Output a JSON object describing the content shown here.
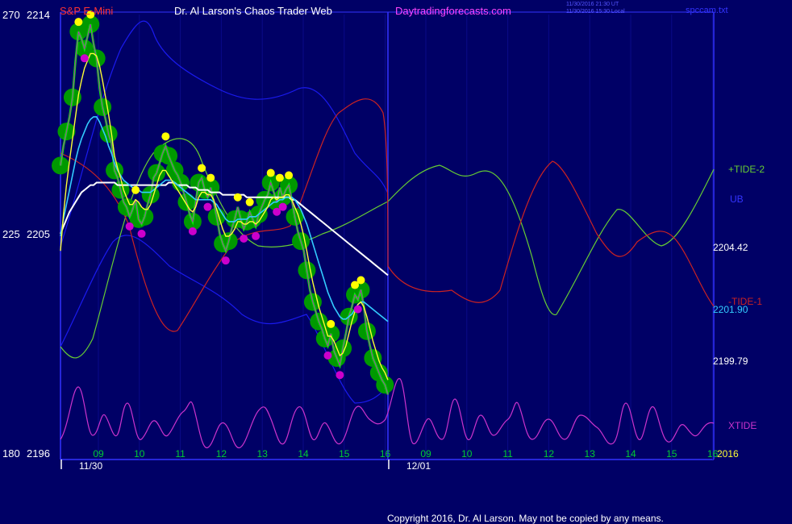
{
  "header": {
    "symbol": "S&P E-Mini",
    "title": "Dr. Al Larson's Chaos Trader Web",
    "site": "Daytradingforecasts.com",
    "stamp_utc": "11/30/2016 21:30 UT",
    "stamp_local": "11/30/2016 15:30 Local",
    "file": "spccam.txt"
  },
  "footer": {
    "copyright": "Copyright 2016, Dr. Al Larson. May not be copied by any means."
  },
  "colors": {
    "background": "#000066",
    "frame": "#3333ff",
    "price": "#00ff00",
    "bubbles": "#009900",
    "highs": "#ffff00",
    "lows": "#cc00cc",
    "fast_ma": "#ffff33",
    "mid_ma": "#33ccff",
    "slow_ma": "#ffffff",
    "bands": "#1a1aee",
    "tide_plus": "#66cc33",
    "tide_minus": "#cc2222",
    "xtide": "#cc33cc"
  },
  "chart_data": {
    "type": "line",
    "y_axis_left": {
      "ticks": [
        {
          "pos": 270,
          "value": 2214
        },
        {
          "pos": 225,
          "value": 2205
        },
        {
          "pos": 180,
          "value": 2196
        }
      ]
    },
    "x_axis": {
      "hour_ticks": [
        "09",
        "10",
        "11",
        "12",
        "13",
        "14",
        "15",
        "16",
        "09",
        "10",
        "11",
        "12",
        "13",
        "14",
        "15",
        "16"
      ],
      "date_labels": [
        "11/30",
        "12/01"
      ],
      "year": "2016"
    },
    "right_labels": [
      {
        "text": "+TIDE-2",
        "color": "#66cc33"
      },
      {
        "text": "UB",
        "color": "#3333ff"
      },
      {
        "text": "2204.42",
        "color": "#ffffff"
      },
      {
        "text": "-TIDE-1",
        "color": "#cc2222"
      },
      {
        "text": "2201.90",
        "color": "#33ccff"
      },
      {
        "text": "2199.79",
        "color": "#ffffff"
      },
      {
        "text": "XTIDE",
        "color": "#cc33cc"
      }
    ],
    "price_series": {
      "name": "S&P E-Mini",
      "y": [
        2207.8,
        2208.6,
        2209.2,
        2209.8,
        2210.6,
        2212.1,
        2213.3,
        2213.0,
        2212.6,
        2213.1,
        2213.6,
        2212.8,
        2212.2,
        2211.0,
        2210.2,
        2209.7,
        2209.1,
        2208.7,
        2207.6,
        2207.3,
        2206.8,
        2206.3,
        2206.1,
        2205.7,
        2206.0,
        2206.4,
        2205.6,
        2205.4,
        2205.7,
        2206.2,
        2206.6,
        2207.3,
        2207.5,
        2207.9,
        2208.3,
        2208.6,
        2208.2,
        2207.9,
        2207.6,
        2207.4,
        2207.1,
        2206.7,
        2206.3,
        2205.8,
        2205.5,
        2206.3,
        2207.1,
        2207.3,
        2206.8,
        2206.5,
        2206.9,
        2206.3,
        2205.7,
        2205.0,
        2204.6,
        2204.3,
        2204.7,
        2205.2,
        2205.6,
        2206.1,
        2205.6,
        2205.2,
        2205.5,
        2205.9,
        2205.6,
        2205.3,
        2205.8,
        2206.1,
        2206.4,
        2206.6,
        2207.1,
        2206.7,
        2206.3,
        2206.9,
        2206.5,
        2206.8,
        2207.0,
        2206.4,
        2205.7,
        2205.1,
        2204.7,
        2204.3,
        2203.5,
        2202.7,
        2202.2,
        2201.8,
        2201.4,
        2201.1,
        2200.7,
        2200.4,
        2200.9,
        2200.2,
        2199.9,
        2199.6,
        2200.3,
        2200.9,
        2201.6,
        2202.0,
        2202.5,
        2202.3,
        2202.7,
        2202.0,
        2201.0,
        2200.4,
        2199.9,
        2199.6,
        2199.3,
        2199.0,
        2198.8,
        2198.4
      ]
    },
    "fast_ma": {
      "y": [
        2204.3,
        2205.8,
        2207.0,
        2208.0,
        2208.9,
        2209.8,
        2210.7,
        2211.3,
        2211.8,
        2212.1,
        2212.4,
        2212.4,
        2212.3,
        2211.9,
        2211.3,
        2210.6,
        2209.9,
        2209.1,
        2208.2,
        2207.7,
        2207.3,
        2206.8,
        2206.5,
        2206.2,
        2206.2,
        2206.4,
        2206.3,
        2206.1,
        2206.0,
        2206.0,
        2206.2,
        2206.6,
        2207.0,
        2207.4,
        2207.6,
        2207.6,
        2207.4,
        2207.2,
        2207.0,
        2206.8,
        2206.6,
        2206.4,
        2206.2,
        2206.0,
        2205.9,
        2206.1,
        2206.5,
        2206.7,
        2206.7,
        2206.6,
        2206.6,
        2206.4,
        2206.0,
        2205.6,
        2205.2,
        2204.9,
        2204.9,
        2205.0,
        2205.2,
        2205.5,
        2205.5,
        2205.4,
        2205.4,
        2205.5,
        2205.5,
        2205.4,
        2205.5,
        2205.7,
        2205.9,
        2206.1,
        2206.4,
        2206.5,
        2206.4,
        2206.5,
        2206.5,
        2206.6,
        2206.6,
        2206.4,
        2206.1,
        2205.8,
        2205.4,
        2204.9,
        2204.3,
        2203.6,
        2203.0,
        2202.5,
        2202.0,
        2201.6,
        2201.2,
        2200.8,
        2200.8,
        2200.6,
        2200.3,
        2200.0,
        2200.1,
        2200.4,
        2200.9,
        2201.4,
        2201.8,
        2202.1,
        2202.2,
        2202.0,
        2201.6,
        2201.1,
        2200.6,
        2200.2,
        2199.8,
        2199.5,
        2199.3,
        2199.0
      ]
    },
    "mid_ma": {
      "y": [
        2204.9,
        2205.6,
        2206.2,
        2206.8,
        2207.4,
        2208.0,
        2208.5,
        2208.9,
        2209.2,
        2209.5,
        2209.7,
        2209.8,
        2209.8,
        2209.6,
        2209.3,
        2209.0,
        2208.6,
        2208.3,
        2207.9,
        2207.6,
        2207.4,
        2207.2,
        2207.1,
        2207.0,
        2206.9,
        2206.9,
        2206.8,
        2206.7,
        2206.7,
        2206.7,
        2206.7,
        2206.8,
        2206.9,
        2207.0,
        2207.1,
        2207.2,
        2207.2,
        2207.2,
        2207.1,
        2207.0,
        2206.9,
        2206.8,
        2206.7,
        2206.6,
        2206.5,
        2206.4,
        2206.4,
        2206.4,
        2206.4,
        2206.4,
        2206.4,
        2206.3,
        2206.2,
        2206.0,
        2205.8,
        2205.6,
        2205.5,
        2205.5,
        2205.5,
        2205.6,
        2205.6,
        2205.6,
        2205.6,
        2205.7,
        2205.7,
        2205.7,
        2205.8,
        2205.9,
        2206.0,
        2206.1,
        2206.2,
        2206.3,
        2206.3,
        2206.4,
        2206.4,
        2206.5,
        2206.5,
        2206.5,
        2206.4,
        2206.2,
        2206.0,
        2205.7,
        2205.4,
        2205.0,
        2204.6,
        2204.2,
        2203.8,
        2203.4,
        2203.0,
        2202.6,
        2202.3,
        2202.0,
        2201.8,
        2201.6,
        2201.5,
        2201.5,
        2201.6,
        2201.7,
        2201.9,
        2202.1,
        2202.2,
        2202.2,
        2202.1,
        2202.0,
        2201.9,
        2201.8,
        2201.7,
        2201.6,
        2201.5,
        2201.4
      ]
    },
    "slow_ma": {
      "y": [
        2205.0,
        2205.3,
        2205.6,
        2205.9,
        2206.1,
        2206.3,
        2206.5,
        2206.7,
        2206.8,
        2206.9,
        2207.0,
        2207.0,
        2207.1,
        2207.1,
        2207.1,
        2207.1,
        2207.1,
        2207.1,
        2207.1,
        2207.0,
        2207.0,
        2207.0,
        2207.0,
        2207.0,
        2207.0,
        2207.0,
        2207.0,
        2207.0,
        2207.0,
        2207.0,
        2207.0,
        2207.0,
        2207.0,
        2207.0,
        2207.0,
        2207.0,
        2207.1,
        2207.1,
        2207.1,
        2207.0,
        2207.0,
        2207.0,
        2207.0,
        2206.9,
        2206.9,
        2206.9,
        2206.8,
        2206.8,
        2206.8,
        2206.8,
        2206.7,
        2206.7,
        2206.7,
        2206.7,
        2206.6,
        2206.6,
        2206.6,
        2206.6,
        2206.6,
        2206.6,
        2206.6,
        2206.6,
        2206.5,
        2206.5,
        2206.5,
        2206.5,
        2206.5,
        2206.5,
        2206.5,
        2206.5,
        2206.5,
        2206.5,
        2206.5,
        2206.5,
        2206.5,
        2206.5,
        2206.5,
        2206.4,
        2206.4,
        2206.3,
        2206.2,
        2206.1,
        2206.0,
        2205.9,
        2205.8,
        2205.7,
        2205.6,
        2205.5,
        2205.4,
        2205.3,
        2205.2,
        2205.1,
        2205.0,
        2204.9,
        2204.8,
        2204.7,
        2204.6,
        2204.5,
        2204.4,
        2204.3,
        2204.2,
        2204.1,
        2204.0,
        2203.9,
        2203.8,
        2203.7,
        2203.6,
        2203.5,
        2203.4,
        2203.3
      ]
    }
  }
}
